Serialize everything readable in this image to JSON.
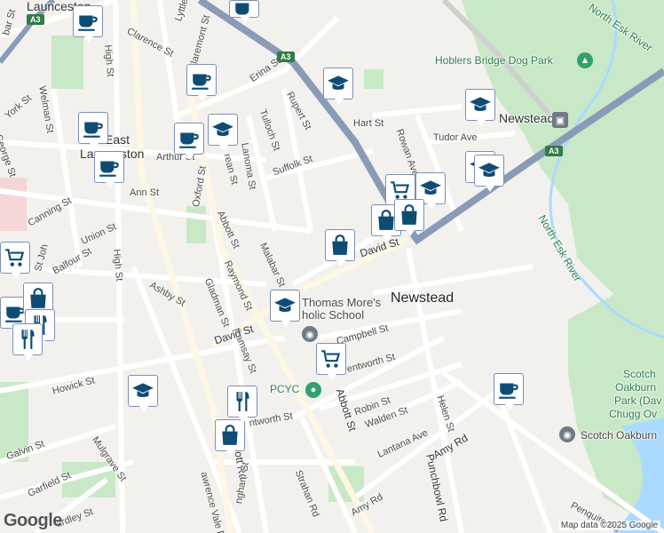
{
  "labels": {
    "launceston": "Launceston",
    "east_launceston_1": "East",
    "east_launceston_2": "Launceston",
    "newstead": "Newstead",
    "hoblers": "Hoblers Bridge Dog Park",
    "north_esk_1": "North Esk River",
    "north_esk_2": "North Esk River",
    "newstead_station": "Newstead",
    "st_thomas_1": "Thomas More's",
    "st_thomas_2": "holic School",
    "pcyc": "PCYC",
    "scotch_1": "Scotch",
    "scotch_2": "Oakburn",
    "scotch_3": "Park (Dav",
    "scotch_4": "Chugg Ov",
    "scotch_college": "Scotch Oakburn",
    "clarence": "Clarence St",
    "lyttleton": "Lyttleton",
    "claremont": "Claremont St",
    "erina": "Erina St",
    "rupert": "Rupert St",
    "tulloch": "Tulloch St",
    "hart": "Hart St",
    "rowan": "Rowan Ave",
    "tudor": "Tudor Ave",
    "lanoma": "Lanoma St",
    "suffolk": "Suffolk St",
    "arthur": "Arthur St",
    "ann": "Ann St",
    "welman": "Welman St",
    "york": "York St",
    "george": "George St",
    "high1": "High St",
    "high2": "High St",
    "canning": "Canning St",
    "union": "Union St",
    "balfour": "Balfour St",
    "oxford": "Oxford St",
    "abbott1": "Abbott St",
    "abbott2": "Abbott St",
    "abbott_rd": "bbott Rd",
    "malabar": "Malabar St",
    "raymond": "Raymond St",
    "gladman": "Gladman St",
    "ramsay": "Ramsay St",
    "ashby": "Ashby St",
    "david1": "David St",
    "david2": "David St",
    "campbell": "Campbell St",
    "wentworth1": "Wentworth St",
    "wentworth2": "ntworth St",
    "howick": "Howick St",
    "mulgrave": "Mulgrave St",
    "galvin": "Galvin St",
    "garfield": "Garfield St",
    "lawrence": "awrence Vale Rd",
    "robin": "Robin St",
    "walden": "Walden St",
    "lantana": "Lantana Ave",
    "helen": "Helen St",
    "amy1": "Amy Rd",
    "amy2": "Amy Rd",
    "punchbowl": "Punchbowl Rd",
    "strahan": "Strahan Rd",
    "penquite": "Penquite Rd",
    "ingham": "ngham St",
    "hardley": "ardley St",
    "bar": "bar St",
    "crean": "rean St",
    "john": "St Joh"
  },
  "shields": {
    "a3_1": "A3",
    "a3_2": "A3",
    "a3_3": "A3"
  },
  "google": "Google",
  "attribution": "Map data ©2025 Google",
  "colors": {
    "pin_icon": "#0f4c75",
    "pin_border": "#7b8fb3",
    "park": "#c9e8c7",
    "water": "#aadaff",
    "major_road": "#8a9bb8"
  }
}
